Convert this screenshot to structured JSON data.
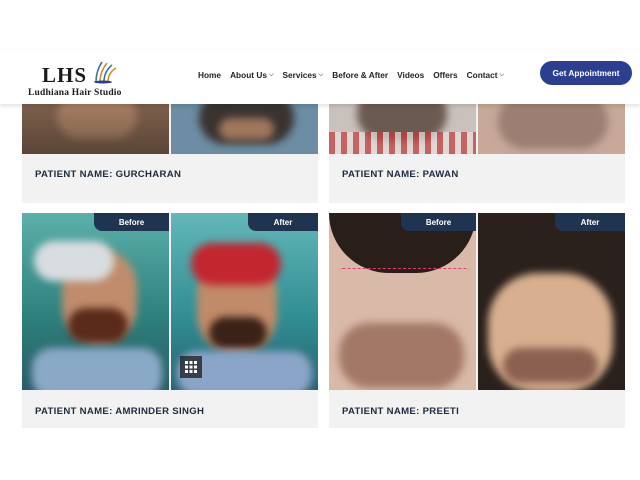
{
  "brand": {
    "logo_main": "LHS",
    "logo_sub": "Ludhiana Hair Studio"
  },
  "nav": [
    {
      "label": "Home",
      "has_dropdown": false
    },
    {
      "label": "About Us",
      "has_dropdown": true
    },
    {
      "label": "Services",
      "has_dropdown": true
    },
    {
      "label": "Before & After",
      "has_dropdown": false
    },
    {
      "label": "Videos",
      "has_dropdown": false
    },
    {
      "label": "Offers",
      "has_dropdown": false
    },
    {
      "label": "Contact",
      "has_dropdown": true
    }
  ],
  "cta": {
    "label": "Get Appointment",
    "color": "#2b3e8f"
  },
  "cards": [
    {
      "caption": "PATIENT NAME: GURCHARAN"
    },
    {
      "caption": "PATIENT NAME: PAWAN"
    },
    {
      "caption": "PATIENT NAME: AMRINDER SINGH",
      "before_label": "Before",
      "after_label": "After"
    },
    {
      "caption": "PATIENT NAME: PREETI",
      "before_label": "Before",
      "after_label": "After"
    }
  ],
  "icons": {
    "dropdown": "chevron-down-icon",
    "gallery": "grid-icon"
  }
}
